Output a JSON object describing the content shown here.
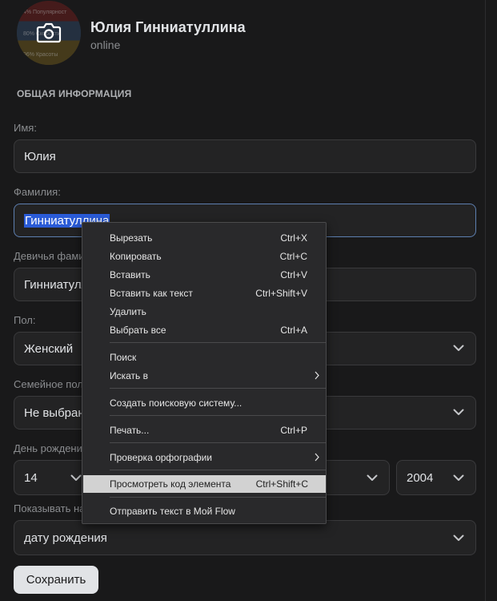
{
  "profile": {
    "name": "Юлия Гинниатуллина",
    "status": "online",
    "avatar_lines": [
      "4% Популярност",
      "80% Скорости",
      "96% Красоты"
    ]
  },
  "section_title": "ОБЩАЯ ИНФОРМАЦИЯ",
  "form": {
    "first_name_label": "Имя:",
    "first_name_value": "Юлия",
    "last_name_label": "Фамилия:",
    "last_name_value": "Гинниатуллина",
    "maiden_label": "Девичья фамилия:",
    "maiden_value": "Гинниатуллина",
    "gender_label": "Пол:",
    "gender_value": "Женский",
    "marital_label": "Семейное положение:",
    "marital_value": "Не выбрано",
    "birthday_label": "День рождения:",
    "birthday_day": "14",
    "birthday_year": "2004",
    "show_label": "Показывать на странице:",
    "show_value": "дату рождения",
    "save_button": "Сохранить"
  },
  "context_menu": {
    "items": [
      {
        "label": "Вырезать",
        "shortcut": "Ctrl+X"
      },
      {
        "label": "Копировать",
        "shortcut": "Ctrl+C"
      },
      {
        "label": "Вставить",
        "shortcut": "Ctrl+V"
      },
      {
        "label": "Вставить как текст",
        "shortcut": "Ctrl+Shift+V"
      },
      {
        "label": "Удалить",
        "shortcut": ""
      },
      {
        "label": "Выбрать все",
        "shortcut": "Ctrl+A"
      },
      {
        "label": "Поиск",
        "shortcut": ""
      },
      {
        "label": "Искать в",
        "shortcut": ""
      },
      {
        "label": "Создать поисковую систему...",
        "shortcut": ""
      },
      {
        "label": "Печать...",
        "shortcut": "Ctrl+P"
      },
      {
        "label": "Проверка орфографии",
        "shortcut": ""
      },
      {
        "label": "Просмотреть код элемента",
        "shortcut": "Ctrl+Shift+C"
      },
      {
        "label": "Отправить текст в Мой Flow",
        "shortcut": ""
      }
    ],
    "highlighted_item": "Просмотреть код элемента"
  },
  "colors": {
    "background": "#19191a",
    "field_bg": "#232324",
    "focus_border": "#5d7fb0",
    "selection": "#2a5bd7",
    "menu_bg": "#29292b",
    "menu_highlight": "#d2d2d2"
  }
}
